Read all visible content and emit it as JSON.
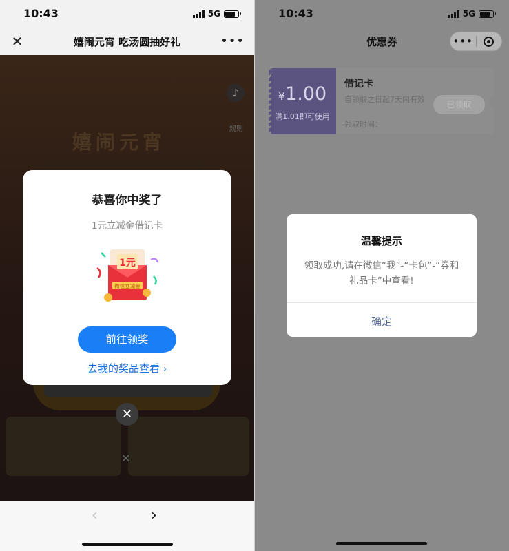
{
  "left": {
    "status": {
      "time": "10:43",
      "network": "5G"
    },
    "nav": {
      "close_icon": "close-icon",
      "title": "嬉闹元宵 吃汤圆抽好礼",
      "more_icon": "more-icon"
    },
    "background": {
      "title_text": "嬉闹元宵",
      "rules_label": "规则"
    },
    "modal": {
      "title": "恭喜你中奖了",
      "subtitle": "1元立减金借记卡",
      "prize_amount": "1元",
      "prize_label": "微信立减金",
      "primary_button": "前往领奖",
      "link_text": "去我的奖品查看",
      "link_chevron": "›"
    },
    "close_button_glyph": "✕",
    "bottom_bar": {
      "back_glyph": "‹",
      "forward_glyph": "›"
    }
  },
  "right": {
    "status": {
      "time": "10:43",
      "network": "5G"
    },
    "nav": {
      "title": "优惠券",
      "more_glyph": "•••"
    },
    "coupon": {
      "currency": "¥",
      "amount": "1.00",
      "condition": "满1.01即可使用",
      "name": "借记卡",
      "description": "自领取之日起7天内有效",
      "time_label": "领取时间：",
      "button": "已领取"
    },
    "dialog": {
      "title": "温馨提示",
      "message": "领取成功,请在微信“我”-“卡包”-“券和礼品卡”中查看!",
      "confirm": "确定"
    }
  },
  "colors": {
    "primary_blue": "#1a7ff7",
    "link_blue": "#1a6fe0",
    "dialog_confirm": "#576b95",
    "coupon_purple": "#5c5480"
  }
}
